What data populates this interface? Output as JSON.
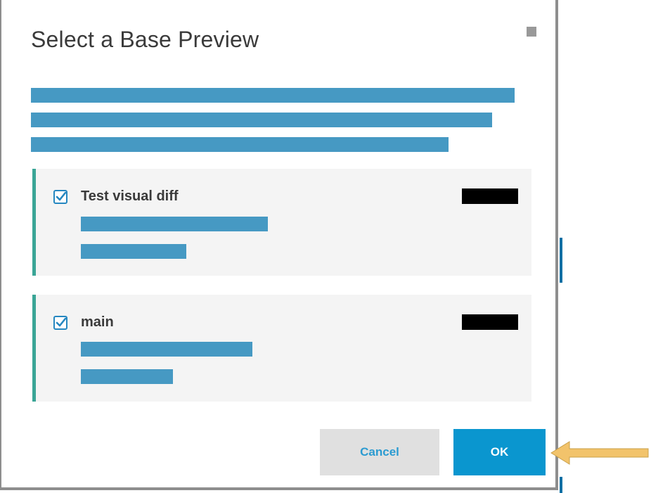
{
  "dialog": {
    "title": "Select a Base Preview",
    "close_icon": "close-icon"
  },
  "items": [
    {
      "label": "Test visual diff",
      "checked": true
    },
    {
      "label": "main",
      "checked": true
    }
  ],
  "footer": {
    "cancel_label": "Cancel",
    "ok_label": "OK"
  },
  "colors": {
    "accent": "#0a96cf",
    "item_border": "#3aa596",
    "cancel_text": "#2b9bd1",
    "annotation_arrow": "#f2c36b"
  }
}
